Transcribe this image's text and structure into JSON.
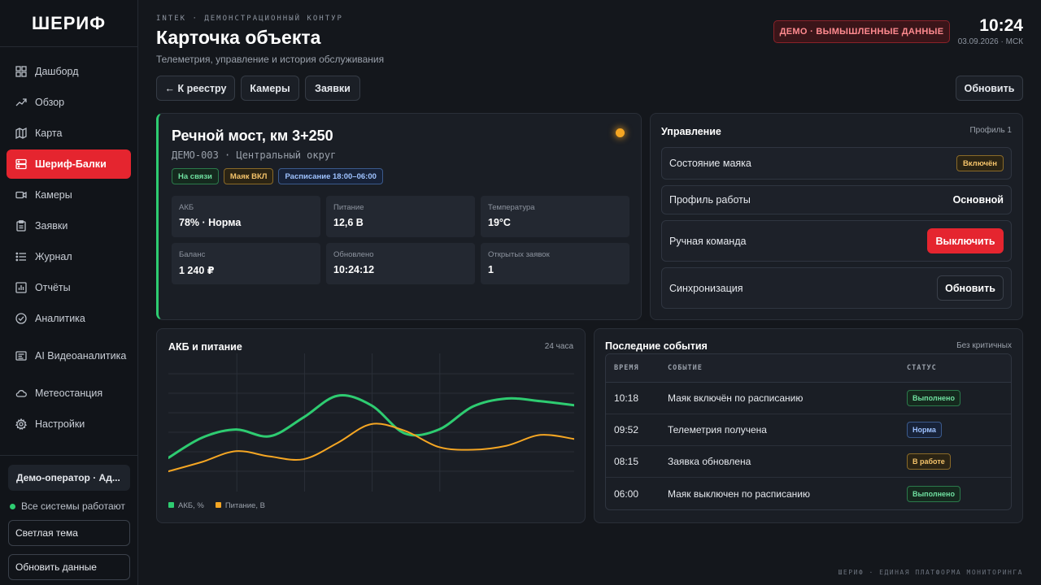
{
  "brand": "ШЕРИФ",
  "sidebar": {
    "items": [
      {
        "label": "Дашборд",
        "icon": "grid-icon"
      },
      {
        "label": "Обзор",
        "icon": "trend-icon"
      },
      {
        "label": "Карта",
        "icon": "map-icon"
      },
      {
        "label": "Шериф-Балки",
        "icon": "server-icon"
      },
      {
        "label": "Камеры",
        "icon": "camera-icon"
      },
      {
        "label": "Заявки",
        "icon": "clipboard-icon"
      },
      {
        "label": "Журнал",
        "icon": "list-icon"
      },
      {
        "label": "Отчёты",
        "icon": "bar-chart-icon"
      },
      {
        "label": "Аналитика",
        "icon": "check-circle-icon"
      },
      {
        "label": "AI Видеоаналитика",
        "icon": "ai-video-icon"
      },
      {
        "label": "Метеостанция",
        "icon": "cloud-icon"
      },
      {
        "label": "Настройки",
        "icon": "gear-icon"
      }
    ],
    "operator": "Демо-оператор · Ад...",
    "system_status": "Все системы работают",
    "theme_button": "Светлая тема",
    "refresh_button": "Обновить данные"
  },
  "header": {
    "eyebrow": "INTEK · ДЕМОНСТРАЦИОННЫЙ КОНТУР",
    "title": "Карточка объекта",
    "subtitle": "Телеметрия, управление и история обслуживания",
    "demo_badge": "ДЕМО · ВЫМЫШЛЕННЫЕ ДАННЫЕ",
    "time": "10:24",
    "date": "03.09.2026 · МСК"
  },
  "toolbar": {
    "back": "← К реестру",
    "cameras": "Камеры",
    "requests": "Заявки",
    "refresh": "Обновить"
  },
  "object": {
    "title": "Речной мост, км 3+250",
    "id": "ДЕМО-003 · Центральный округ",
    "tags": [
      "На связи",
      "Маяк ВКЛ",
      "Расписание 18:00–06:00"
    ],
    "metrics": [
      {
        "label": "АКБ",
        "value": "78% · Норма"
      },
      {
        "label": "Питание",
        "value": "12,6 В"
      },
      {
        "label": "Температура",
        "value": "19°C"
      },
      {
        "label": "Баланс",
        "value": "1 240 ₽"
      },
      {
        "label": "Обновлено",
        "value": "10:24:12"
      },
      {
        "label": "Открытых заявок",
        "value": "1"
      }
    ],
    "status_color": "#f5a623"
  },
  "control": {
    "title": "Управление",
    "profile": "Профиль 1",
    "beacon_label": "Состояние маяка",
    "beacon_value": "Включён",
    "mode_label": "Профиль работы",
    "mode_value": "Основной",
    "manual_label": "Ручная команда",
    "manual_button": "Выключить",
    "sync_label": "Синхронизация",
    "sync_button": "Обновить"
  },
  "chart": {
    "title": "АКБ и питание",
    "range": "24 часа"
  },
  "chart_data": {
    "type": "line",
    "title": "АКБ и питание",
    "x": [
      0,
      1,
      2,
      3,
      4,
      5,
      6,
      7,
      8,
      9,
      10,
      11,
      12
    ],
    "xlabel": "",
    "ylabel": "",
    "ylim": [
      0,
      100
    ],
    "grid": true,
    "legend": "bottom-left",
    "series": [
      {
        "name": "АКБ, %",
        "color": "#2ecc71",
        "values": [
          25,
          40,
          46,
          41,
          55,
          71,
          64,
          43,
          46,
          63,
          69,
          67,
          64
        ]
      },
      {
        "name": "Питание, В",
        "color": "#f5a623",
        "values": [
          15,
          22,
          30,
          26,
          24,
          36,
          50,
          45,
          33,
          31,
          34,
          42,
          39
        ]
      }
    ]
  },
  "events": {
    "title": "Последние события",
    "note": "Без критичных",
    "columns": [
      "ВРЕМЯ",
      "СОБЫТИЕ",
      "СТАТУС"
    ],
    "rows": [
      {
        "time": "10:18",
        "event": "Маяк включён по расписанию",
        "status": "Выполнено"
      },
      {
        "time": "09:52",
        "event": "Телеметрия получена",
        "status": "Норма"
      },
      {
        "time": "08:15",
        "event": "Заявка обновлена",
        "status": "В работе"
      },
      {
        "time": "06:00",
        "event": "Маяк выключен по расписанию",
        "status": "Выполнено"
      }
    ]
  },
  "footer": "ШЕРИФ · ЕДИНАЯ ПЛАТФОРМА МОНИТОРИНГА",
  "colors": {
    "accent": "#e5252f",
    "ok": "#2ecc71",
    "warn": "#f5a623",
    "info": "#9ec2ff"
  }
}
